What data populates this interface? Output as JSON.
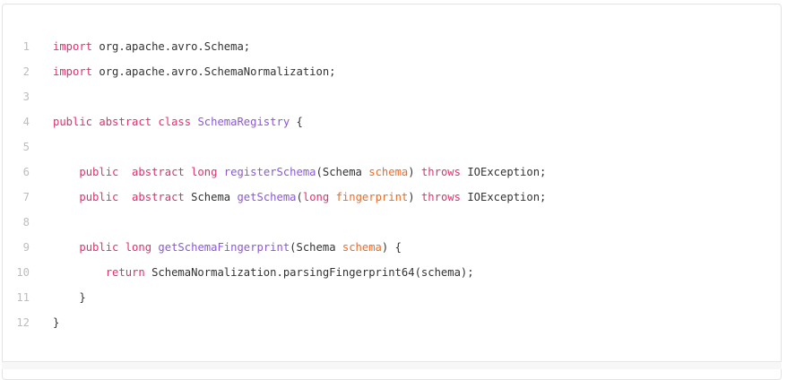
{
  "code_block": {
    "lines": [
      {
        "number": "1",
        "tokens": [
          {
            "t": "import",
            "c": "kw"
          },
          {
            "t": " org.apache.avro.Schema;",
            "c": "plain"
          }
        ]
      },
      {
        "number": "2",
        "tokens": [
          {
            "t": "import",
            "c": "kw"
          },
          {
            "t": " org.apache.avro.SchemaNormalization;",
            "c": "plain"
          }
        ]
      },
      {
        "number": "3",
        "tokens": []
      },
      {
        "number": "4",
        "tokens": [
          {
            "t": "public abstract class",
            "c": "kw"
          },
          {
            "t": " ",
            "c": "plain"
          },
          {
            "t": "SchemaRegistry",
            "c": "fn"
          },
          {
            "t": " {",
            "c": "plain"
          }
        ]
      },
      {
        "number": "5",
        "tokens": []
      },
      {
        "number": "6",
        "tokens": [
          {
            "t": "    ",
            "c": "plain"
          },
          {
            "t": "public  abstract long",
            "c": "kw"
          },
          {
            "t": " ",
            "c": "plain"
          },
          {
            "t": "registerSchema",
            "c": "fn"
          },
          {
            "t": "(Schema ",
            "c": "plain"
          },
          {
            "t": "schema",
            "c": "var"
          },
          {
            "t": ") ",
            "c": "plain"
          },
          {
            "t": "throws",
            "c": "kw"
          },
          {
            "t": " IOException;",
            "c": "plain"
          }
        ]
      },
      {
        "number": "7",
        "tokens": [
          {
            "t": "    ",
            "c": "plain"
          },
          {
            "t": "public  abstract",
            "c": "kw"
          },
          {
            "t": " Schema ",
            "c": "plain"
          },
          {
            "t": "getSchema",
            "c": "fn"
          },
          {
            "t": "(",
            "c": "plain"
          },
          {
            "t": "long",
            "c": "kw"
          },
          {
            "t": " ",
            "c": "plain"
          },
          {
            "t": "fingerprint",
            "c": "var"
          },
          {
            "t": ") ",
            "c": "plain"
          },
          {
            "t": "throws",
            "c": "kw"
          },
          {
            "t": " IOException;",
            "c": "plain"
          }
        ]
      },
      {
        "number": "8",
        "tokens": []
      },
      {
        "number": "9",
        "tokens": [
          {
            "t": "    ",
            "c": "plain"
          },
          {
            "t": "public long",
            "c": "kw"
          },
          {
            "t": " ",
            "c": "plain"
          },
          {
            "t": "getSchemaFingerprint",
            "c": "fn"
          },
          {
            "t": "(Schema ",
            "c": "plain"
          },
          {
            "t": "schema",
            "c": "var"
          },
          {
            "t": ") {",
            "c": "plain"
          }
        ]
      },
      {
        "number": "10",
        "tokens": [
          {
            "t": "        ",
            "c": "plain"
          },
          {
            "t": "return",
            "c": "kw"
          },
          {
            "t": " SchemaNormalization.parsingFingerprint64(schema);",
            "c": "plain"
          }
        ]
      },
      {
        "number": "11",
        "tokens": [
          {
            "t": "    }",
            "c": "plain"
          }
        ]
      },
      {
        "number": "12",
        "tokens": [
          {
            "t": "}",
            "c": "plain"
          }
        ]
      }
    ]
  },
  "colors": {
    "keyword": "#e3306c",
    "function_name": "#8a58d9",
    "parameter": "#f06a24",
    "plain": "#333333",
    "line_number": "#bdbdbd"
  }
}
